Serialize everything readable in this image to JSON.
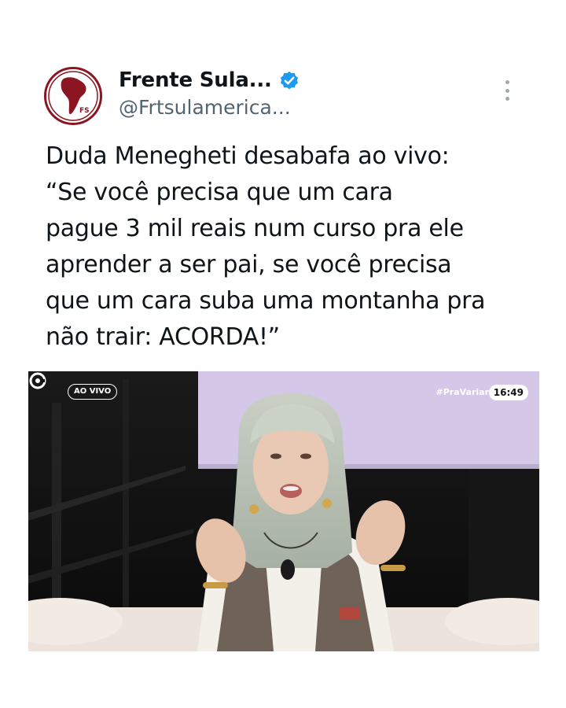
{
  "author": {
    "display_name": "Frente Sula...",
    "handle": "@Frtsulamerica...",
    "avatar_initials": "FS",
    "verified": true
  },
  "tweet": {
    "lines": [
      "Duda Menegheti desabafa ao vivo:",
      "“Se você precisa que um cara",
      "pague 3 mil reais num curso pra ele",
      "aprender a ser pai, se você precisa",
      "que um cara suba uma montanha pra",
      "não trair: ACORDA!”"
    ]
  },
  "video": {
    "live_label": "AO VIVO",
    "hashtag": "#PraVariar",
    "clock": "16:49"
  },
  "icons": {
    "verified": "verified-badge-icon",
    "more": "more-options-icon",
    "channel_logo": "channel-logo-icon"
  },
  "colors": {
    "brand_red": "#8b1520",
    "verified_blue": "#1d9bf0",
    "handle_gray": "#536471",
    "backdrop_lavender": "#d4c7e8"
  }
}
